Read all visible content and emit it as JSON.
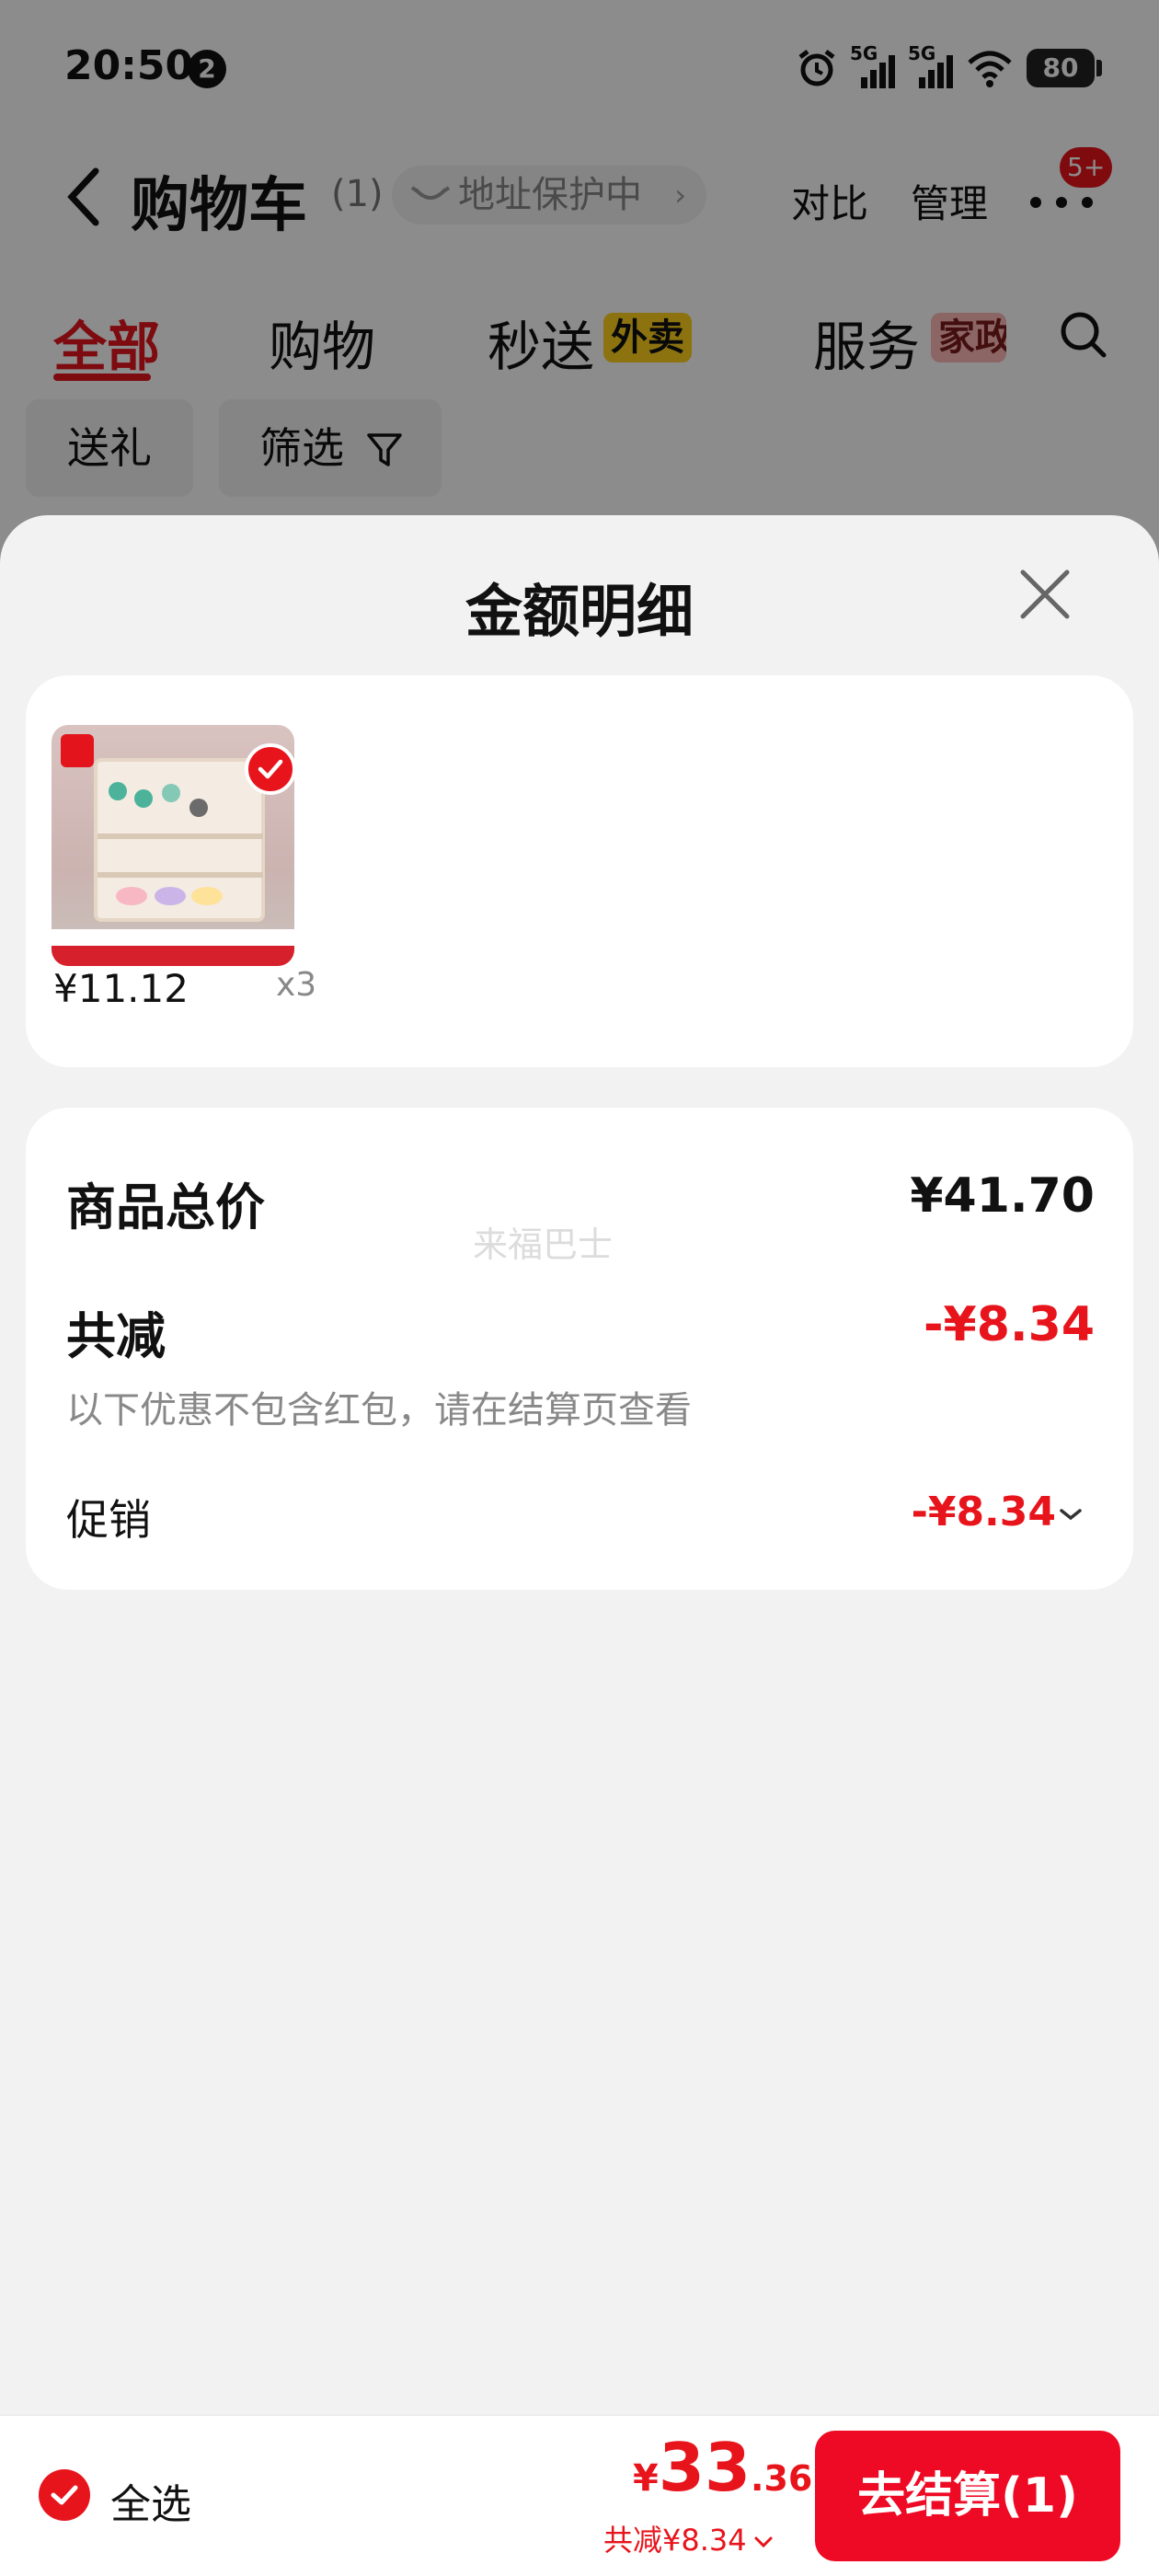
{
  "status_bar": {
    "time": "20:50",
    "notification_count": "2",
    "network_1": "5G",
    "network_2": "5G",
    "battery": "80"
  },
  "header": {
    "title": "购物车",
    "count": "(1)",
    "address_protection": "地址保护中",
    "compare_label": "对比",
    "manage_label": "管理",
    "more_badge": "5+"
  },
  "tabs": [
    {
      "label": "全部",
      "active": true
    },
    {
      "label": "购物"
    },
    {
      "label": "秒送",
      "tag": "外卖"
    },
    {
      "label": "服务",
      "tag": "家政"
    }
  ],
  "filters": {
    "gift_label": "送礼",
    "filter_label": "筛选"
  },
  "sheet": {
    "title": "金额明细",
    "product": {
      "price": "¥11.12",
      "quantity": "x3",
      "selected": true
    },
    "summary": {
      "total_label": "商品总价",
      "total_value": "¥41.70",
      "discount_label": "共减",
      "discount_value": "-¥8.34",
      "note": "以下优惠不包含红包，请在结算页查看",
      "promo_label": "促销",
      "promo_value": "-¥8.34"
    },
    "watermark": "来福巴士"
  },
  "bottom_bar": {
    "select_all_label": "全选",
    "currency": "¥",
    "total_integer": "33",
    "total_decimal": ".36",
    "discount_text": "共减¥8.34",
    "checkout_label": "去结算(1)"
  },
  "colors": {
    "accent": "#e8141c",
    "checkout": "#ee0a24",
    "tag_yellow": "#ffd21e",
    "tag_pink": "#ffb9b9"
  }
}
